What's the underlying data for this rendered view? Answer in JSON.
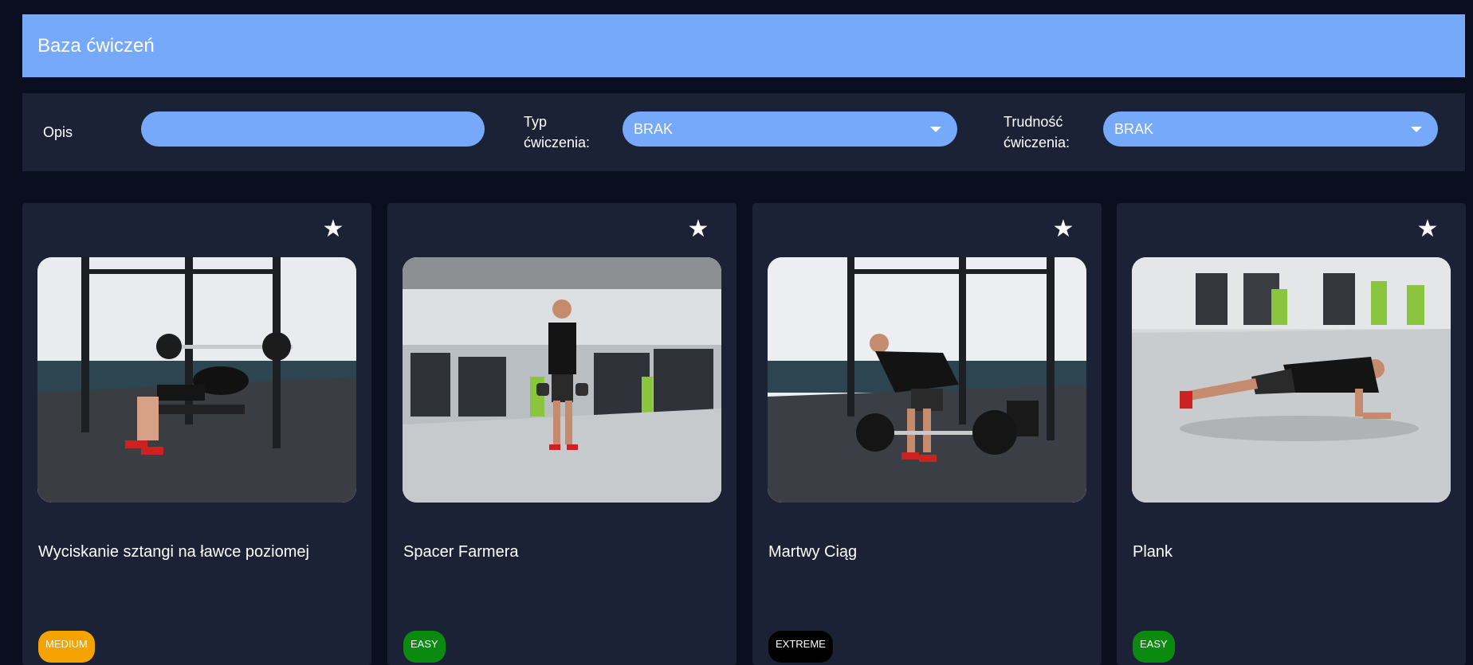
{
  "header": {
    "title": "Baza ćwiczeń"
  },
  "filters": {
    "description_label": "Opis",
    "description_value": "",
    "type_label": "Typ ćwiczenia:",
    "type_value": "BRAK",
    "difficulty_label": "Trudność ćwiczenia:",
    "difficulty_value": "BRAK"
  },
  "colors": {
    "accent": "#76a9fa",
    "background": "#0a0f1f",
    "panel": "#1b2236",
    "medium": "#f5a300",
    "easy": "#0b8a10",
    "extreme": "#000000"
  },
  "exercises": [
    {
      "title": "Wyciskanie sztangi na ławce poziomej",
      "difficulty": "MEDIUM",
      "favorite_icon": "star-icon"
    },
    {
      "title": "Spacer Farmera",
      "difficulty": "EASY",
      "favorite_icon": "star-icon"
    },
    {
      "title": "Martwy Ciąg",
      "difficulty": "EXTREME",
      "favorite_icon": "star-icon"
    },
    {
      "title": "Plank",
      "difficulty": "EASY",
      "favorite_icon": "star-icon"
    }
  ]
}
